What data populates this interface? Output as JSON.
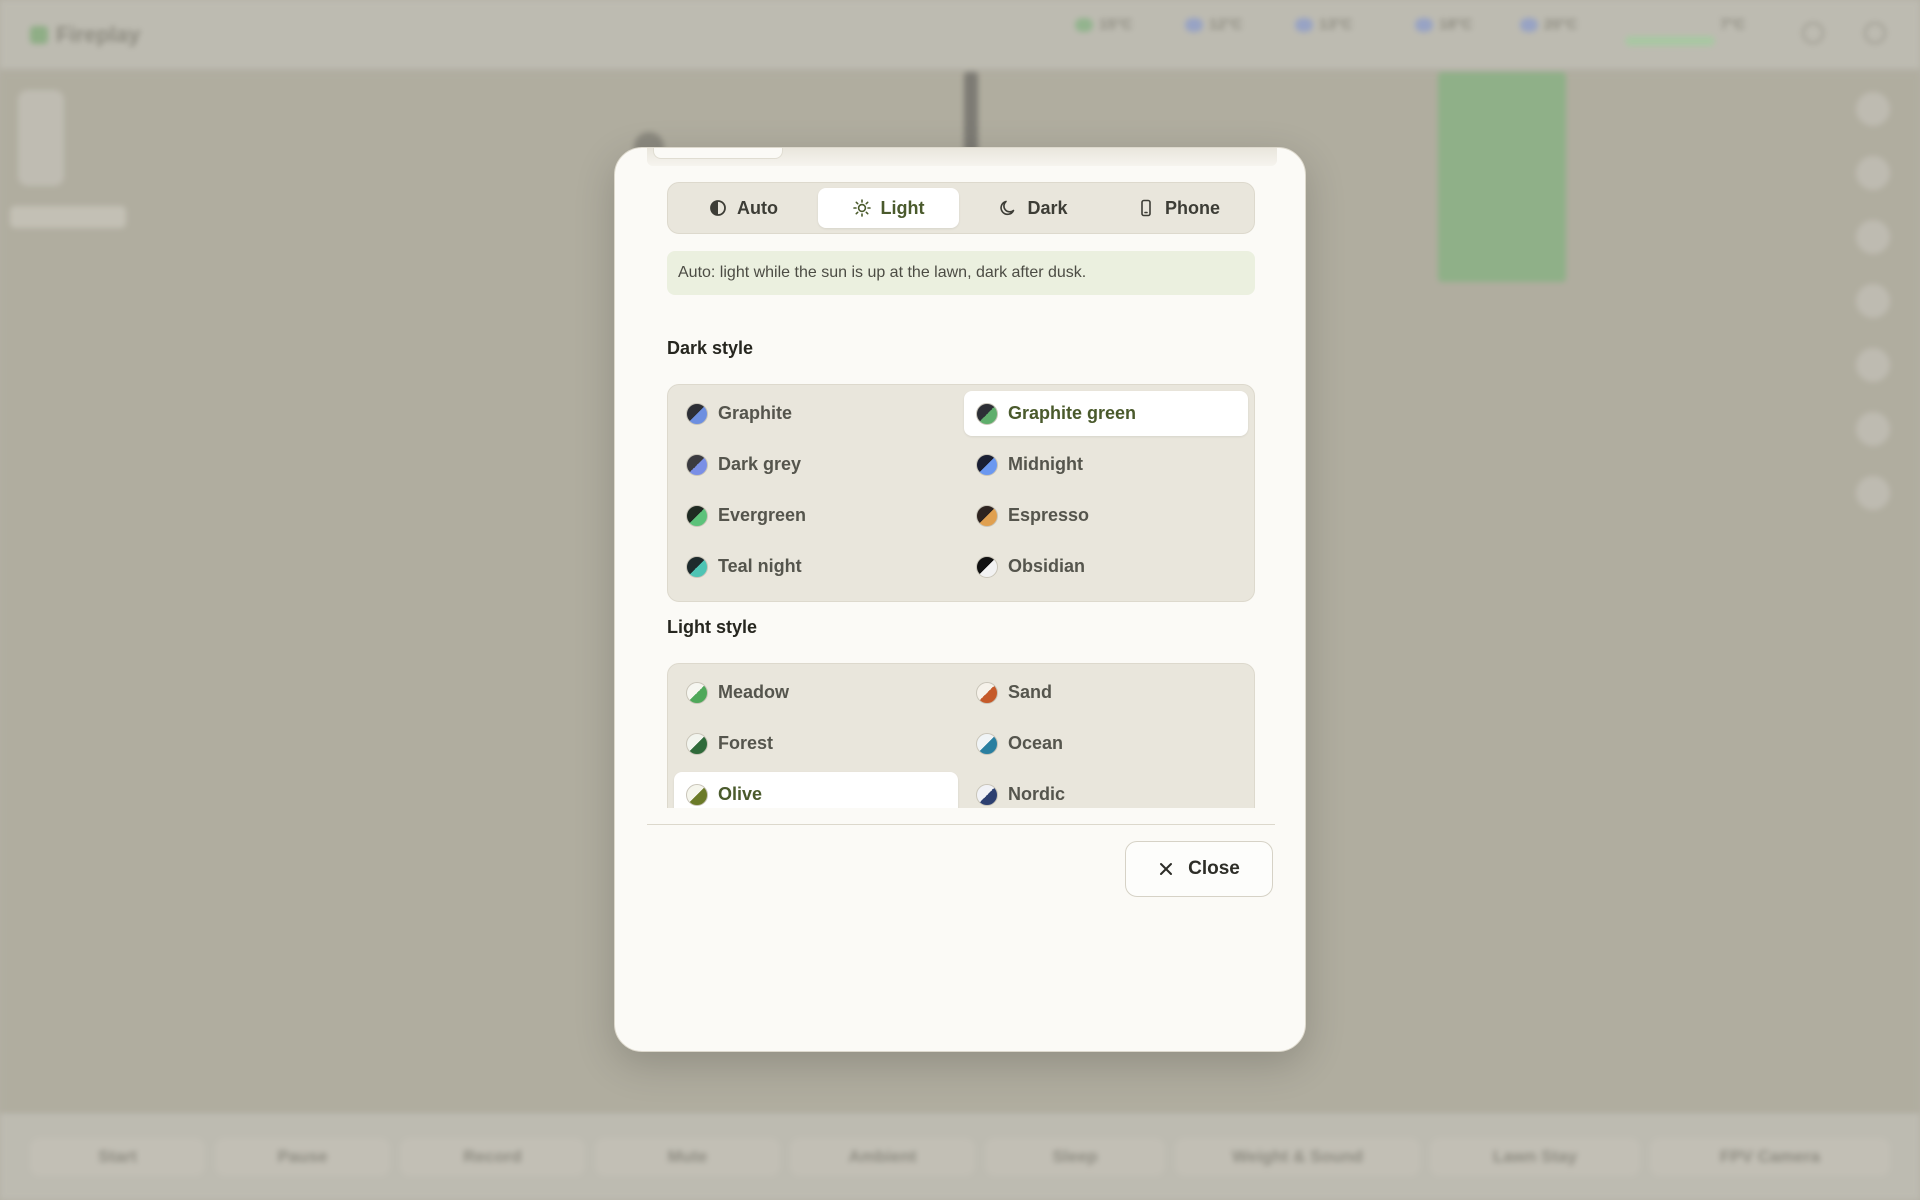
{
  "background": {
    "app_name": "Fireplay",
    "weather": [
      "15°C",
      "12°C",
      "13°C",
      "18°C",
      "20°C"
    ],
    "top_right_value": "7°C",
    "bottom_buttons": [
      "Start",
      "Pause",
      "Record",
      "Mute",
      "Ambient",
      "Sleep",
      "Weight & Sound",
      "Lawn Stay",
      "FPV Camera"
    ]
  },
  "theme_dialog": {
    "modes": [
      {
        "label": "Auto",
        "icon": "half-circle-icon",
        "active": false
      },
      {
        "label": "Light",
        "icon": "sun-icon",
        "active": true
      },
      {
        "label": "Dark",
        "icon": "moon-icon",
        "active": false
      },
      {
        "label": "Phone",
        "icon": "phone-icon",
        "active": false
      }
    ],
    "info_text": "Auto: light while the sun is up at the lawn, dark after dusk.",
    "dark_style": {
      "title": "Dark style",
      "options": [
        {
          "label": "Graphite",
          "dark": "#2d2f36",
          "accent": "#6d8fe0",
          "selected": false
        },
        {
          "label": "Graphite green",
          "dark": "#2d2f36",
          "accent": "#5fae6c",
          "selected": true
        },
        {
          "label": "Dark grey",
          "dark": "#3b3b40",
          "accent": "#7a8fe6",
          "selected": false
        },
        {
          "label": "Midnight",
          "dark": "#1a1f33",
          "accent": "#6b98f0",
          "selected": false
        },
        {
          "label": "Evergreen",
          "dark": "#1f2a22",
          "accent": "#5cc27a",
          "selected": false
        },
        {
          "label": "Espresso",
          "dark": "#2e2420",
          "accent": "#e0a050",
          "selected": false
        },
        {
          "label": "Teal night",
          "dark": "#1e2a2c",
          "accent": "#4ec4b4",
          "selected": false
        },
        {
          "label": "Obsidian",
          "dark": "#111111",
          "accent": "#f2f2f2",
          "selected": false
        }
      ]
    },
    "light_style": {
      "title": "Light style",
      "options": [
        {
          "label": "Meadow",
          "light": "#f6f6f0",
          "accent": "#4fa85a",
          "selected": false
        },
        {
          "label": "Sand",
          "light": "#f6f2ea",
          "accent": "#c55a2a",
          "selected": false
        },
        {
          "label": "Forest",
          "light": "#f2f4ee",
          "accent": "#2f6a3a",
          "selected": false
        },
        {
          "label": "Ocean",
          "light": "#f0f4f6",
          "accent": "#2a7fa0",
          "selected": false
        },
        {
          "label": "Olive",
          "light": "#f5f5ec",
          "accent": "#6b7a28",
          "selected": true
        },
        {
          "label": "Nordic",
          "light": "#f1f2f6",
          "accent": "#2c3f70",
          "selected": false
        }
      ]
    },
    "close_label": "Close"
  }
}
